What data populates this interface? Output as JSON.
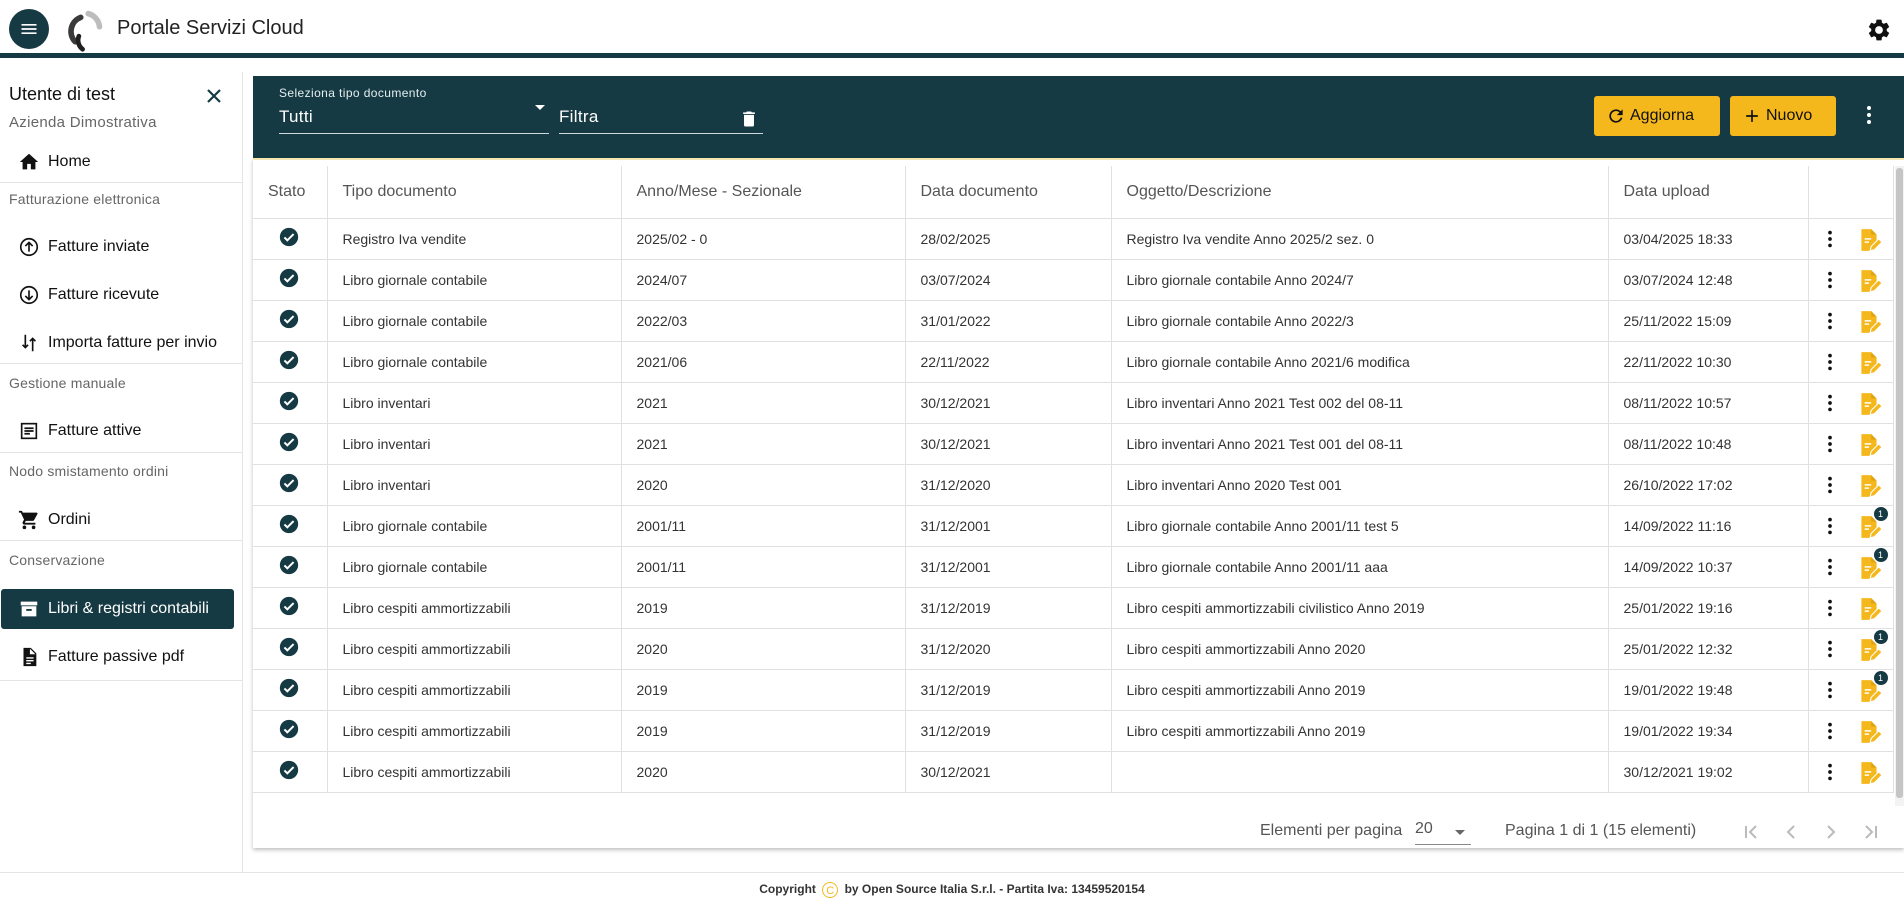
{
  "app": {
    "title": "Portale Servizi Cloud"
  },
  "colors": {
    "primary": "#163a43",
    "accent": "#f5b81c"
  },
  "user": {
    "name": "Utente di test",
    "company": "Azienda Dimostrativa"
  },
  "sidebar": {
    "home": "Home",
    "sections": [
      {
        "title": "Fatturazione elettronica",
        "items": [
          "Fatture inviate",
          "Fatture ricevute",
          "Importa fatture per invio"
        ]
      },
      {
        "title": "Gestione manuale",
        "items": [
          "Fatture attive"
        ]
      },
      {
        "title": "Nodo smistamento ordini",
        "items": [
          "Ordini"
        ]
      },
      {
        "title": "Conservazione",
        "items": [
          "Libri & registri contabili",
          "Fatture passive pdf"
        ]
      }
    ],
    "active": "Libri & registri contabili"
  },
  "toolbar": {
    "select_label": "Seleziona tipo documento",
    "select_value": "Tutti",
    "filter_placeholder": "Filtra",
    "refresh_label": "Aggiorna",
    "new_label": "Nuovo"
  },
  "table": {
    "columns": [
      "Stato",
      "Tipo documento",
      "Anno/Mese - Sezionale",
      "Data documento",
      "Oggetto/Descrizione",
      "Data upload"
    ],
    "rows": [
      {
        "tipo": "Registro Iva vendite",
        "anno": "2025/02 - 0",
        "data": "28/02/2025",
        "oggetto": "Registro Iva vendite Anno 2025/2 sez. 0",
        "upload": "03/04/2025 18:33",
        "badge": ""
      },
      {
        "tipo": "Libro giornale contabile",
        "anno": "2024/07",
        "data": "03/07/2024",
        "oggetto": "Libro giornale contabile Anno 2024/7",
        "upload": "03/07/2024 12:48",
        "badge": ""
      },
      {
        "tipo": "Libro giornale contabile",
        "anno": "2022/03",
        "data": "31/01/2022",
        "oggetto": "Libro giornale contabile Anno 2022/3",
        "upload": "25/11/2022 15:09",
        "badge": ""
      },
      {
        "tipo": "Libro giornale contabile",
        "anno": "2021/06",
        "data": "22/11/2022",
        "oggetto": "Libro giornale contabile Anno 2021/6 modifica",
        "upload": "22/11/2022 10:30",
        "badge": ""
      },
      {
        "tipo": "Libro inventari",
        "anno": "2021",
        "data": "30/12/2021",
        "oggetto": "Libro inventari Anno 2021 Test 002 del 08-11",
        "upload": "08/11/2022 10:57",
        "badge": ""
      },
      {
        "tipo": "Libro inventari",
        "anno": "2021",
        "data": "30/12/2021",
        "oggetto": "Libro inventari Anno 2021 Test 001 del 08-11",
        "upload": "08/11/2022 10:48",
        "badge": ""
      },
      {
        "tipo": "Libro inventari",
        "anno": "2020",
        "data": "31/12/2020",
        "oggetto": "Libro inventari Anno 2020 Test 001",
        "upload": "26/10/2022 17:02",
        "badge": ""
      },
      {
        "tipo": "Libro giornale contabile",
        "anno": "2001/11",
        "data": "31/12/2001",
        "oggetto": "Libro giornale contabile Anno 2001/11 test 5",
        "upload": "14/09/2022 11:16",
        "badge": "1"
      },
      {
        "tipo": "Libro giornale contabile",
        "anno": "2001/11",
        "data": "31/12/2001",
        "oggetto": "Libro giornale contabile Anno 2001/11 aaa",
        "upload": "14/09/2022 10:37",
        "badge": "1"
      },
      {
        "tipo": "Libro cespiti ammortizzabili",
        "anno": "2019",
        "data": "31/12/2019",
        "oggetto": "Libro cespiti ammortizzabili civilistico Anno 2019",
        "upload": "25/01/2022 19:16",
        "badge": ""
      },
      {
        "tipo": "Libro cespiti ammortizzabili",
        "anno": "2020",
        "data": "31/12/2020",
        "oggetto": "Libro cespiti ammortizzabili Anno 2020",
        "upload": "25/01/2022 12:32",
        "badge": "1"
      },
      {
        "tipo": "Libro cespiti ammortizzabili",
        "anno": "2019",
        "data": "31/12/2019",
        "oggetto": "Libro cespiti ammortizzabili Anno 2019",
        "upload": "19/01/2022 19:48",
        "badge": "1"
      },
      {
        "tipo": "Libro cespiti ammortizzabili",
        "anno": "2019",
        "data": "31/12/2019",
        "oggetto": "Libro cespiti ammortizzabili Anno 2019",
        "upload": "19/01/2022 19:34",
        "badge": ""
      },
      {
        "tipo": "Libro cespiti ammortizzabili",
        "anno": "2020",
        "data": "30/12/2021",
        "oggetto": "",
        "upload": "30/12/2021 19:02",
        "badge": ""
      }
    ]
  },
  "pagination": {
    "per_page_label": "Elementi per pagina",
    "per_page": "20",
    "info": "Pagina 1 di 1 (15 elementi)"
  },
  "footer": {
    "prefix": "Copyright",
    "symbol": "C",
    "text": "by Open Source Italia S.r.l. - Partita Iva: 13459520154"
  },
  "icons": {
    "menu": "menu-icon",
    "logo": "logo-icon",
    "settings": "gear-icon",
    "close": "close-icon",
    "home": "home-icon",
    "sent": "upload-circle-icon",
    "received": "download-circle-icon",
    "import": "swap-vertical-icon",
    "active": "document-list-icon",
    "orders": "cart-icon",
    "books": "archive-icon",
    "pdf": "file-text-icon",
    "trash": "trash-icon",
    "refresh": "refresh-icon",
    "new": "plus-icon",
    "more": "more-vertical-icon",
    "status": "check-circle-icon",
    "doc": "document-edit-icon"
  }
}
